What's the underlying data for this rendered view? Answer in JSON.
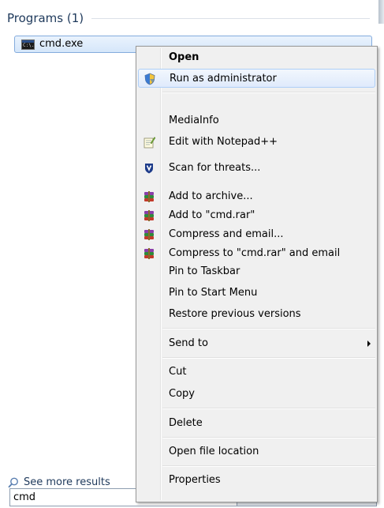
{
  "start_menu": {
    "section_title": "Programs (1)",
    "result_item": {
      "label": "cmd.exe",
      "icon": "cmd-icon",
      "icon_text": "C:\\."
    },
    "see_more": {
      "label": "See more results",
      "icon": "magnifier-icon"
    },
    "search": {
      "value": "cmd"
    }
  },
  "context_menu": {
    "items": [
      {
        "label": "Open",
        "bold": true
      },
      {
        "label": "Run as administrator",
        "icon": "uac-shield-icon",
        "hover": true
      },
      {
        "label": "MediaInfo"
      },
      {
        "label": "Edit with Notepad++",
        "icon": "notepad-plus-plus-icon"
      },
      {
        "label": "Scan for threats...",
        "icon": "antivirus-shield-icon"
      },
      {
        "label": "Add to archive...",
        "icon": "winrar-icon"
      },
      {
        "label": "Add to \"cmd.rar\"",
        "icon": "winrar-icon"
      },
      {
        "label": "Compress and email...",
        "icon": "winrar-icon"
      },
      {
        "label": "Compress to \"cmd.rar\" and email",
        "icon": "winrar-icon"
      },
      {
        "label": "Pin to Taskbar"
      },
      {
        "label": "Pin to Start Menu"
      },
      {
        "label": "Restore previous versions"
      },
      {
        "label": "Send to",
        "submenu": true
      },
      {
        "label": "Cut"
      },
      {
        "label": "Copy"
      },
      {
        "label": "Delete"
      },
      {
        "label": "Open file location"
      },
      {
        "label": "Properties"
      }
    ]
  },
  "colors": {
    "section_title": "#1e395b",
    "menu_background": "#f0f0f0",
    "hover_border": "#aecff7"
  }
}
